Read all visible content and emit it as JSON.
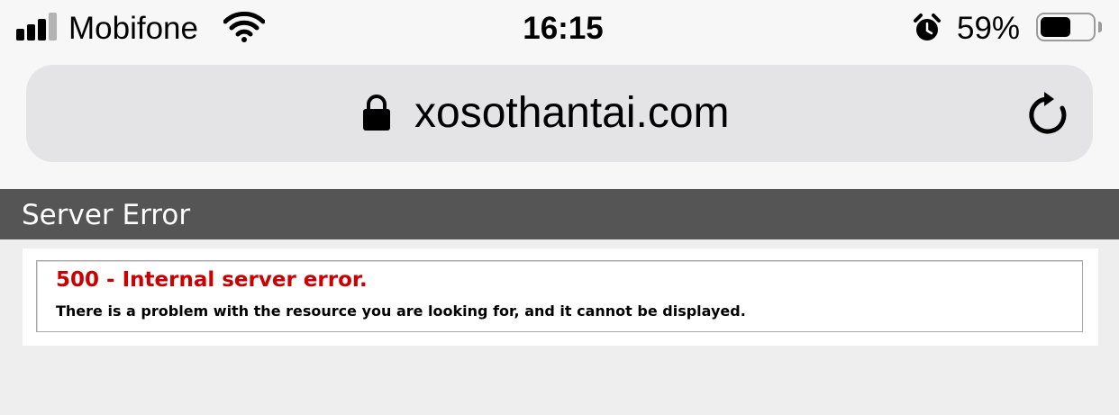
{
  "status_bar": {
    "carrier": "Mobifone",
    "time": "16:15",
    "battery_percent": "59%",
    "battery_level": 0.59,
    "signal_bars_active": 3,
    "signal_bars_total": 4,
    "icons": [
      "signal-icon",
      "wifi-icon",
      "alarm-icon",
      "battery-icon"
    ]
  },
  "address_bar": {
    "url": "xosothantai.com",
    "icons": [
      "lock-icon",
      "reload-icon"
    ]
  },
  "page": {
    "header_title": "Server Error",
    "error_title": "500 - Internal server error.",
    "error_message": "There is a problem with the resource you are looking for, and it cannot be displayed."
  },
  "colors": {
    "header_bg": "#555555",
    "error_red": "#cc0000",
    "page_bg": "#eeeeee"
  }
}
